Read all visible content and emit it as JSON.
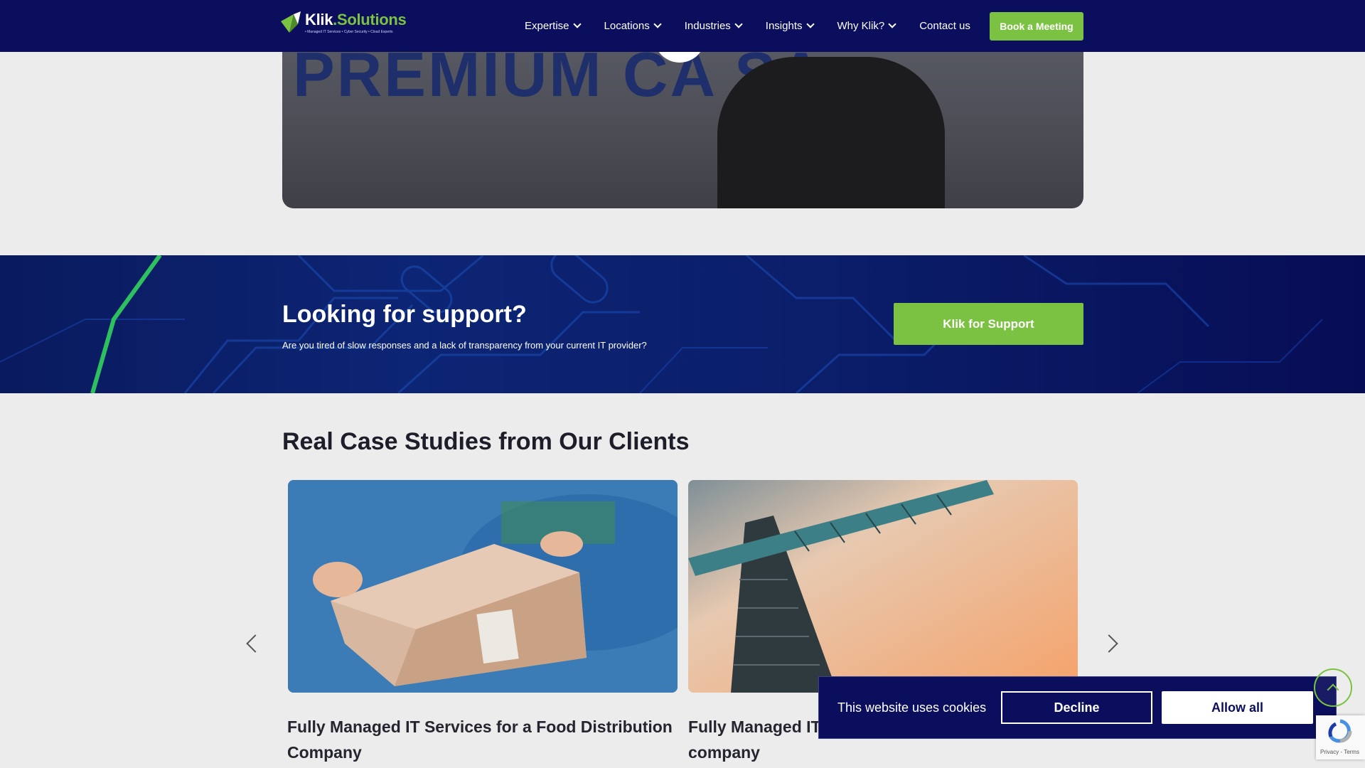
{
  "nav": {
    "logo_main": "Klik",
    "logo_accent": ".Solutions",
    "logo_sub": "• Managed IT Services • Cyber Security • Cloud Experts",
    "items": [
      {
        "label": "Expertise",
        "has_dropdown": true
      },
      {
        "label": "Locations",
        "has_dropdown": true
      },
      {
        "label": "Industries",
        "has_dropdown": true
      },
      {
        "label": "Insights",
        "has_dropdown": true
      },
      {
        "label": "Why Klik?",
        "has_dropdown": true
      },
      {
        "label": "Contact us",
        "has_dropdown": false
      }
    ],
    "cta_label": "Book a Meeting"
  },
  "video": {
    "background_text": "PREMIUM CA   SA"
  },
  "support": {
    "title": "Looking for support?",
    "subtitle": "Are you tired of slow responses and a lack of transparency from your current IT provider?",
    "button_label": "Klik for Support"
  },
  "case_studies": {
    "heading": "Real Case Studies from Our Clients",
    "cards": [
      {
        "title": "Fully Managed IT Services for a Food Distribution Company"
      },
      {
        "title": "Fully Managed IT Services for a Construction company"
      }
    ]
  },
  "cookie": {
    "text": "This website uses cookies",
    "decline_label": "Decline",
    "allow_label": "Allow all"
  },
  "recaptcha": {
    "text": "Privacy - Terms"
  },
  "colors": {
    "nav_bg": "#0b0e5c",
    "accent_green": "#7cc242",
    "page_bg": "#ececec"
  }
}
